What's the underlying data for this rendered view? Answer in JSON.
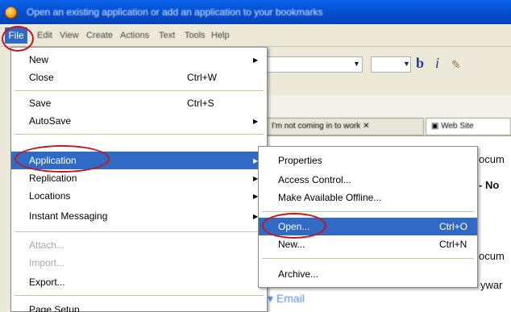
{
  "window": {
    "title": "Open an existing application or add an application to your bookmarks"
  },
  "menubar": {
    "items": [
      "File",
      "Edit",
      "View",
      "Create",
      "Actions",
      "Text",
      "Tools",
      "Help"
    ]
  },
  "toolbar": {
    "bold": "b",
    "italic": "i"
  },
  "background": {
    "tab1": "I'm not coming in to work",
    "tab2": "Web Site",
    "frag_docum1": "ocum",
    "frag_no": "- No",
    "frag_docum2": "ocum",
    "frag_keyword": "ywar",
    "email_heading": "Email"
  },
  "file_menu": {
    "items": [
      {
        "label": "New",
        "shortcut": "",
        "submenu": true
      },
      {
        "label": "Close",
        "shortcut": "Ctrl+W",
        "submenu": false
      },
      {
        "label": "Save",
        "shortcut": "Ctrl+S",
        "submenu": false
      },
      {
        "label": "AutoSave",
        "shortcut": "",
        "submenu": true
      },
      {
        "label": "Application",
        "shortcut": "",
        "submenu": true,
        "highlighted": true
      },
      {
        "label": "Replication",
        "shortcut": "",
        "submenu": true
      },
      {
        "label": "Locations",
        "shortcut": "",
        "submenu": true
      },
      {
        "label": "Instant Messaging",
        "shortcut": "",
        "submenu": true
      },
      {
        "label": "Attach...",
        "shortcut": "",
        "disabled": true
      },
      {
        "label": "Import...",
        "shortcut": "",
        "disabled": true
      },
      {
        "label": "Export...",
        "shortcut": ""
      },
      {
        "label": "Page Setup",
        "shortcut": ""
      }
    ]
  },
  "application_menu": {
    "items": [
      {
        "label": "Properties",
        "shortcut": ""
      },
      {
        "label": "Access Control...",
        "shortcut": ""
      },
      {
        "label": "Make Available Offline...",
        "shortcut": ""
      },
      {
        "label": "Open...",
        "shortcut": "Ctrl+O",
        "highlighted": true
      },
      {
        "label": "New...",
        "shortcut": "Ctrl+N"
      },
      {
        "label": "Archive...",
        "shortcut": ""
      }
    ]
  },
  "colors": {
    "highlight": "#316ac5",
    "annotation": "#c0181e",
    "titlebar": "#0550d2"
  }
}
